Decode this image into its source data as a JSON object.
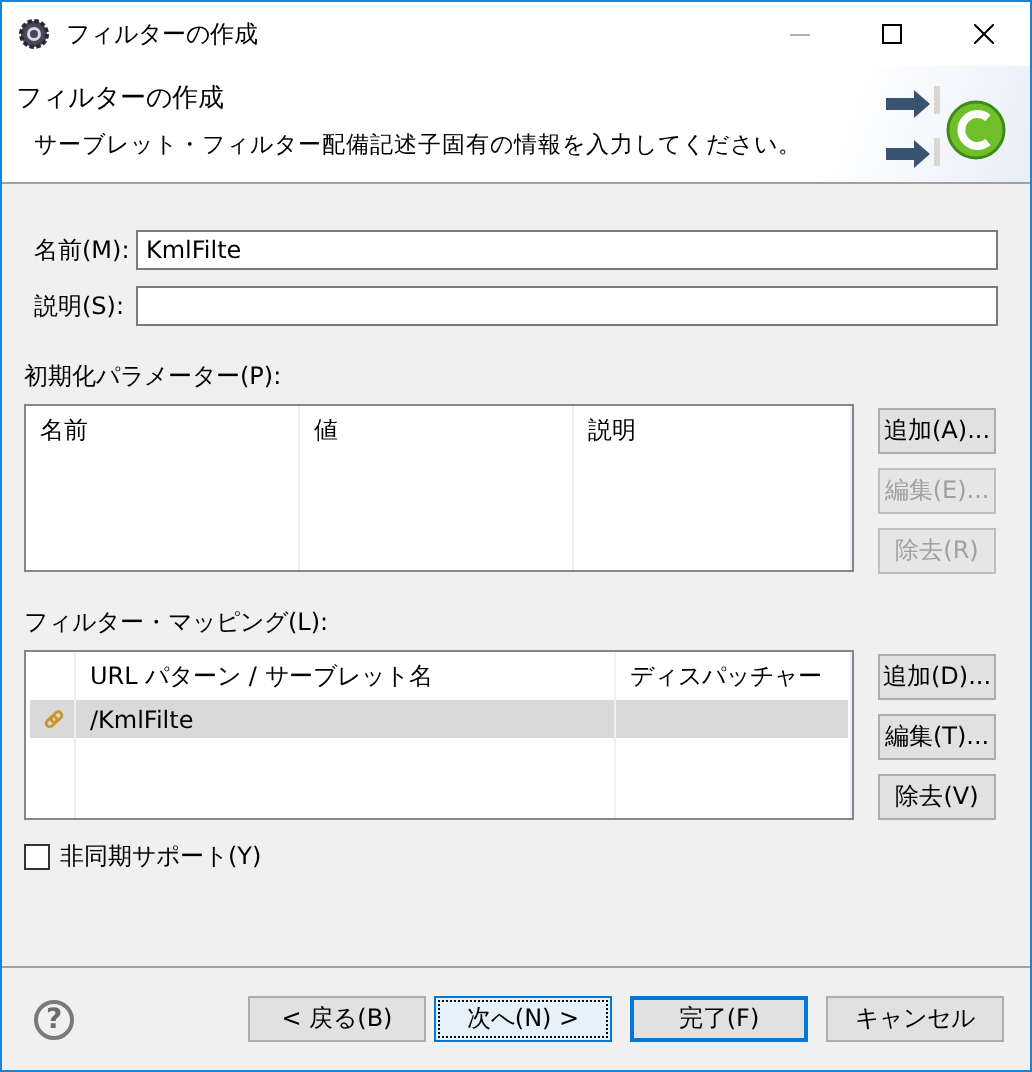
{
  "window": {
    "title": "フィルターの作成"
  },
  "header": {
    "title": "フィルターの作成",
    "description": "サーブレット・フィルター配備記述子固有の情報を入力してください。"
  },
  "fields": [
    {
      "label": "名前(M):",
      "value": "KmlFilte"
    },
    {
      "label": "説明(S):"
    }
  ],
  "init_params": {
    "label": "初期化パラメーター(P):",
    "columns": [
      "名前",
      "値",
      "説明"
    ],
    "buttons": [
      {
        "label": "追加(A)...",
        "disabled": false
      },
      {
        "label": "編集(E)...",
        "disabled": true
      },
      {
        "label": "除去(R)",
        "disabled": true
      }
    ]
  },
  "filter_mappings": {
    "label": "フィルター・マッピング(L):",
    "columns": [
      "URL パターン / サーブレット名",
      "ディスパッチャー"
    ],
    "rows": [
      {
        "pattern": "/KmlFilte",
        "selected": true
      }
    ],
    "buttons": [
      {
        "label": "追加(D)...",
        "disabled": false
      },
      {
        "label": "編集(T)...",
        "disabled": false
      },
      {
        "label": "除去(V)",
        "disabled": false
      }
    ]
  },
  "async_support": {
    "label": "非同期サポート(Y)",
    "checked": false
  },
  "help_button": {
    "label": "?"
  },
  "buttons": [
    {
      "label": "< 戻る(B)",
      "disabled": false,
      "focused": false,
      "default": false
    },
    {
      "label": "次へ(N) >",
      "disabled": false,
      "focused": true,
      "default": false
    },
    {
      "label": "完了(F)",
      "disabled": false,
      "focused": false,
      "default": true
    },
    {
      "label": "キャンセル",
      "disabled": false,
      "focused": false,
      "default": false
    }
  ]
}
